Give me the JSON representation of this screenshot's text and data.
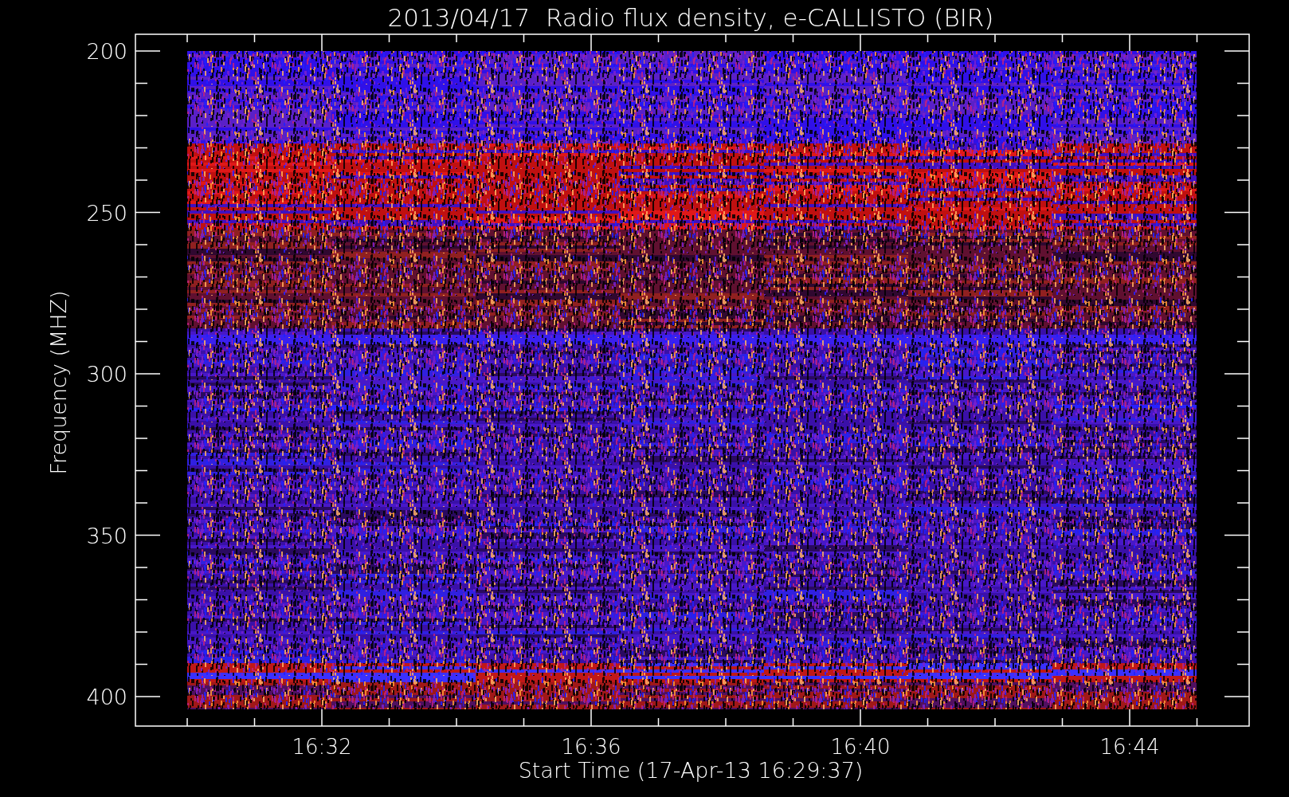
{
  "title": "2013/04/17  Radio flux density, e-CALLISTO (BIR)",
  "y_axis": {
    "label": "Frequency (MHZ)",
    "ticks": [
      "200",
      "250",
      "300",
      "350",
      "400"
    ]
  },
  "x_axis": {
    "label": "Start Time (17-Apr-13 16:29:37)",
    "ticks": [
      "16:32",
      "16:36",
      "16:40",
      "16:44"
    ]
  }
}
